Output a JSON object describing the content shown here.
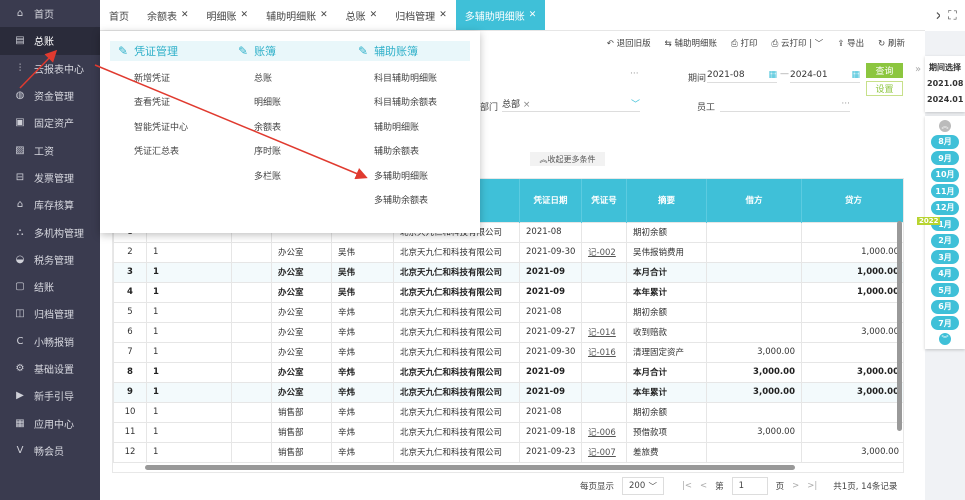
{
  "sidebar": {
    "items": [
      {
        "label": "首页",
        "icon": "home-icon"
      },
      {
        "label": "总账",
        "icon": "ledger-icon",
        "active": true
      },
      {
        "label": "云报表中心",
        "icon": "chart-icon"
      },
      {
        "label": "资金管理",
        "icon": "money-bag-icon"
      },
      {
        "label": "固定资产",
        "icon": "asset-icon"
      },
      {
        "label": "工资",
        "icon": "salary-icon"
      },
      {
        "label": "发票管理",
        "icon": "invoice-icon"
      },
      {
        "label": "库存核算",
        "icon": "warehouse-icon"
      },
      {
        "label": "多机构管理",
        "icon": "org-icon"
      },
      {
        "label": "税务管理",
        "icon": "tax-icon"
      },
      {
        "label": "结账",
        "icon": "checkout-icon"
      },
      {
        "label": "归档管理",
        "icon": "archive-icon"
      },
      {
        "label": "小畅报销",
        "icon": "reimburse-icon"
      },
      {
        "label": "基础设置",
        "icon": "gear-icon"
      },
      {
        "label": "新手引导",
        "icon": "guide-icon"
      },
      {
        "label": "应用中心",
        "icon": "app-icon"
      },
      {
        "label": "畅会员",
        "icon": "vip-icon"
      }
    ]
  },
  "tabs": [
    {
      "label": "首页",
      "closable": false
    },
    {
      "label": "余额表",
      "closable": true
    },
    {
      "label": "明细账",
      "closable": true
    },
    {
      "label": "辅助明细账",
      "closable": true
    },
    {
      "label": "总账",
      "closable": true
    },
    {
      "label": "归档管理",
      "closable": true
    },
    {
      "label": "多辅助明细账",
      "closable": true,
      "active": true
    }
  ],
  "toolbar": {
    "back_old": "退回旧版",
    "aux_detail": "辅助明细账",
    "print": "打印",
    "cloud_print": "云打印",
    "export": "导出",
    "refresh": "刷新"
  },
  "filters": {
    "period_label": "期间",
    "period_start": "2021-08",
    "period_end": "2024-01",
    "dept_label": "部门",
    "dept_tag": "总部",
    "employee_label": "员工",
    "query": "查询",
    "settings": "设置",
    "collapse": "收起更多条件"
  },
  "menu": {
    "columns": [
      {
        "title": "凭证管理",
        "items": [
          "新增凭证",
          "查看凭证",
          "智能凭证中心",
          "凭证汇总表"
        ]
      },
      {
        "title": "账簿",
        "items": [
          "总账",
          "明细账",
          "余额表",
          "序时账",
          "多栏账"
        ]
      },
      {
        "title": "辅助账簿",
        "items": [
          "科目辅助明细账",
          "科目辅助余额表",
          "辅助明细账",
          "辅助余额表",
          "多辅助明细账",
          "多辅助余额表"
        ]
      }
    ]
  },
  "table": {
    "headers": [
      "",
      "",
      "",
      "",
      "",
      "",
      "凭证日期",
      "凭证号",
      "摘要",
      "借方",
      "贷方"
    ],
    "rows": [
      [
        "1",
        "",
        "",
        "",
        "",
        "北京天九仁和科技有限公司",
        "2021-08",
        "",
        "期初余额",
        "",
        ""
      ],
      [
        "2",
        "1",
        "",
        "办公室",
        "吴伟",
        "北京天九仁和科技有限公司",
        "2021-09-30",
        "记-002",
        "吴伟报销费用",
        "",
        "1,000.00"
      ],
      [
        "3",
        "1",
        "",
        "办公室",
        "吴伟",
        "北京天九仁和科技有限公司",
        "2021-09",
        "",
        "本月合计",
        "",
        "1,000.00"
      ],
      [
        "4",
        "1",
        "",
        "办公室",
        "吴伟",
        "北京天九仁和科技有限公司",
        "2021-09",
        "",
        "本年累计",
        "",
        "1,000.00"
      ],
      [
        "5",
        "1",
        "",
        "办公室",
        "辛炜",
        "北京天九仁和科技有限公司",
        "2021-08",
        "",
        "期初余额",
        "",
        ""
      ],
      [
        "6",
        "1",
        "",
        "办公室",
        "辛炜",
        "北京天九仁和科技有限公司",
        "2021-09-27",
        "记-014",
        "收到赔款",
        "",
        "3,000.00"
      ],
      [
        "7",
        "1",
        "",
        "办公室",
        "辛炜",
        "北京天九仁和科技有限公司",
        "2021-09-30",
        "记-016",
        "清理固定资产",
        "3,000.00",
        ""
      ],
      [
        "8",
        "1",
        "",
        "办公室",
        "辛炜",
        "北京天九仁和科技有限公司",
        "2021-09",
        "",
        "本月合计",
        "3,000.00",
        "3,000.00"
      ],
      [
        "9",
        "1",
        "",
        "办公室",
        "辛炜",
        "北京天九仁和科技有限公司",
        "2021-09",
        "",
        "本年累计",
        "3,000.00",
        "3,000.00"
      ],
      [
        "10",
        "1",
        "",
        "销售部",
        "辛炜",
        "北京天九仁和科技有限公司",
        "2021-08",
        "",
        "期初余额",
        "",
        ""
      ],
      [
        "11",
        "1",
        "",
        "销售部",
        "辛炜",
        "北京天九仁和科技有限公司",
        "2021-09-18",
        "记-006",
        "预借款项",
        "3,000.00",
        ""
      ],
      [
        "12",
        "1",
        "",
        "销售部",
        "辛炜",
        "北京天九仁和科技有限公司",
        "2021-09-23",
        "记-007",
        "差旅费",
        "",
        "3,000.00"
      ]
    ],
    "bold_rows": [
      3,
      4,
      8,
      9
    ]
  },
  "pager": {
    "per_page_label": "每页显示",
    "per_page": "200",
    "page_prefix": "第",
    "page": "1",
    "page_suffix": "页",
    "summary": "共1页, 14条记录"
  },
  "period_panel": {
    "title": "期间选择",
    "start": "2021.08",
    "end": "2024.01",
    "year_badge": "2022",
    "months": [
      "8月",
      "9月",
      "10月",
      "11月",
      "12月",
      "1月",
      "2月",
      "3月",
      "4月",
      "5月",
      "6月",
      "7月"
    ]
  },
  "colors": {
    "accent": "#3fc0d8",
    "sidebar": "#3a3b4f",
    "query_button": "#8cc63f",
    "annotation_arrow": "#e03a2f"
  }
}
